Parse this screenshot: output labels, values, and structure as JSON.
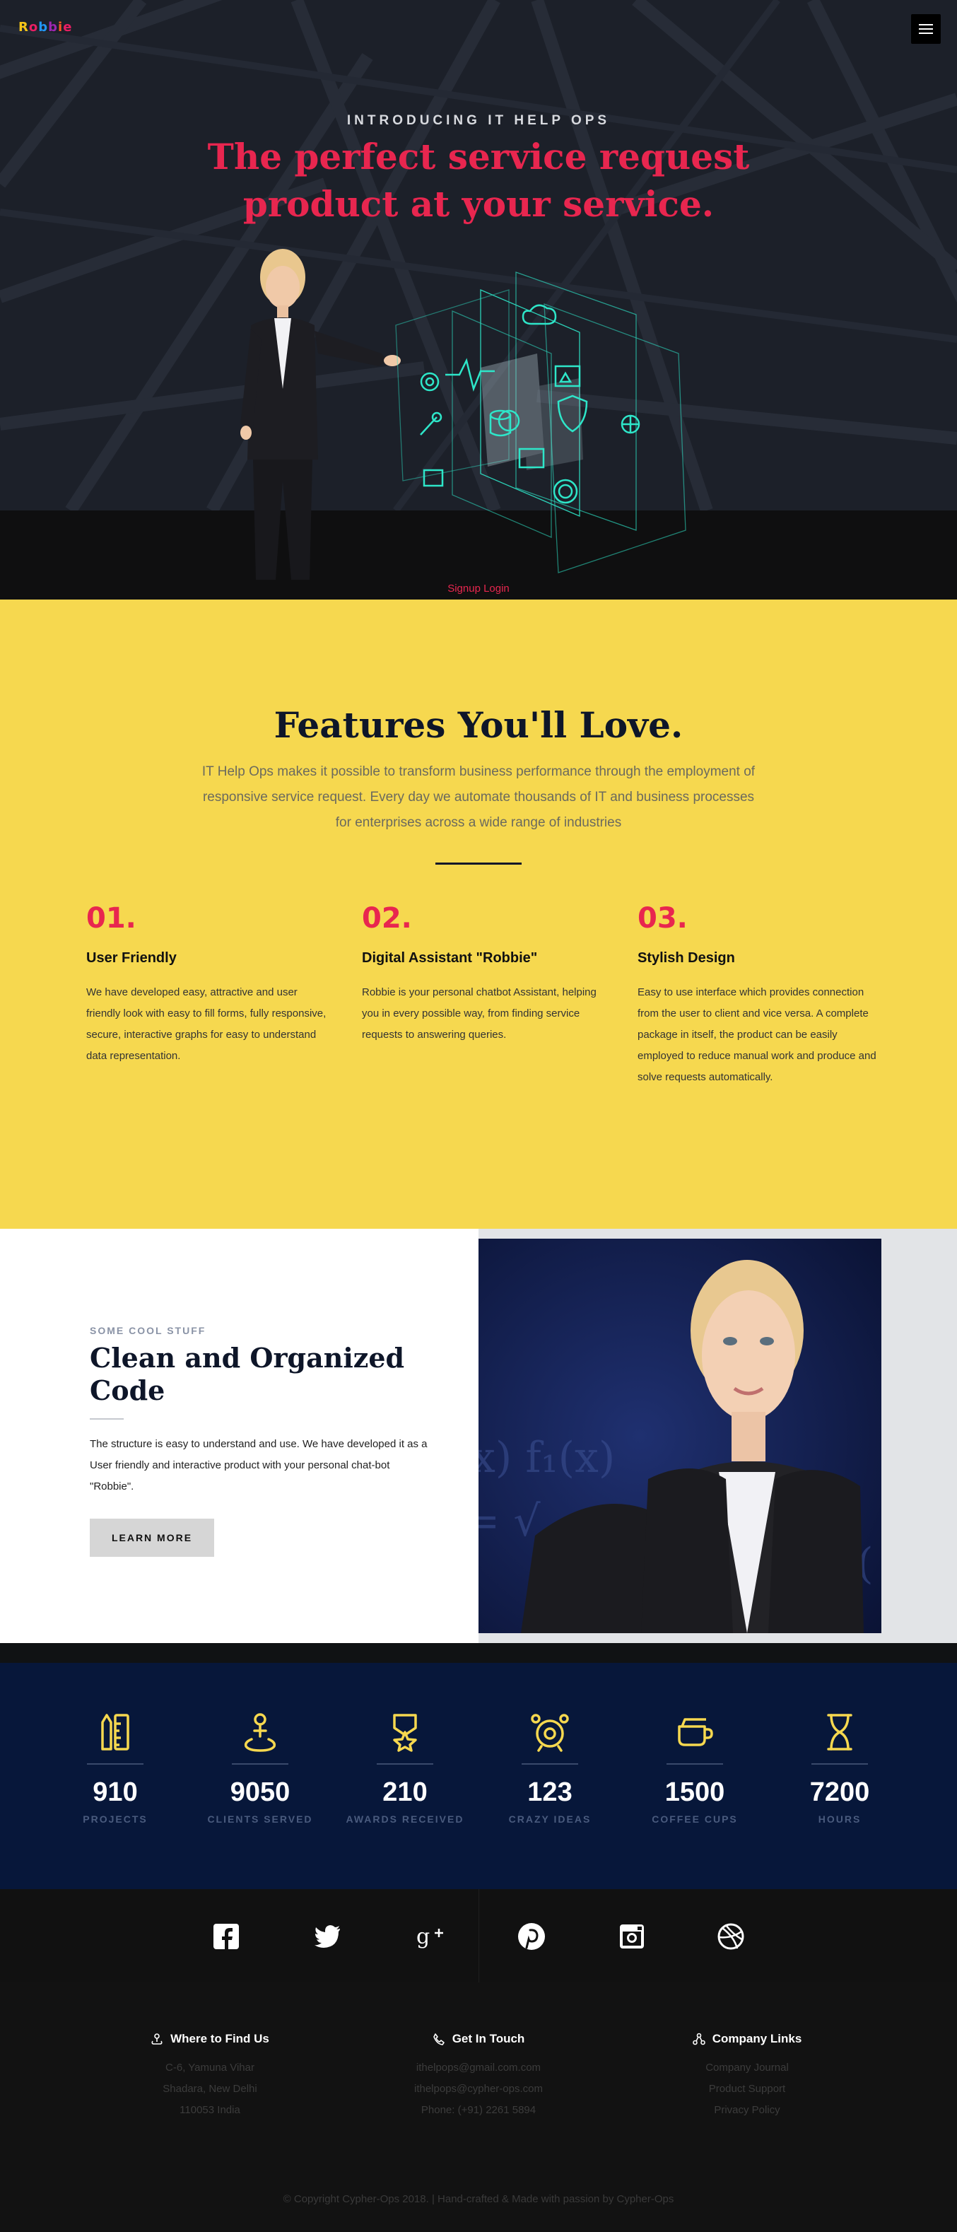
{
  "header": {
    "logo_text": "Robbie",
    "menu_icon": "hamburger-icon"
  },
  "hero": {
    "eyebrow": "INTRODUCING IT HELP OPS",
    "title": "The perfect service request product at your service.",
    "links": "Signup Login"
  },
  "features": {
    "title": "Features You'll Love.",
    "subtitle": "IT Help Ops makes it possible to transform business performance through the employment of responsive service request. Every day we automate thousands of IT and business processes for enterprises across a wide range of industries",
    "items": [
      {
        "num": "01.",
        "title": "User Friendly",
        "desc": "We have developed easy, attractive and user friendly look with easy to fill forms, fully responsive, secure, interactive graphs for easy to understand data representation."
      },
      {
        "num": "02.",
        "title": "Digital Assistant \"Robbie\"",
        "desc": "Robbie is your personal chatbot Assistant, helping you in every possible way, from finding service requests to answering queries."
      },
      {
        "num": "03.",
        "title": "Stylish Design",
        "desc": "Easy to use interface which provides connection from the user to client and vice versa. A complete package in itself, the product can be easily employed to reduce manual work and produce and solve requests automatically."
      }
    ]
  },
  "code_section": {
    "eyebrow": "SOME COOL STUFF",
    "title": "Clean and Organized Code",
    "desc": "The structure is easy to understand and use. We have developed it as a User friendly and interactive product with your personal chat-bot \"Robbie\".",
    "button": "LEARN MORE"
  },
  "stats": [
    {
      "icon": "ruler-pencil-icon",
      "value": "910",
      "label": "PROJECTS"
    },
    {
      "icon": "user-pin-icon",
      "value": "9050",
      "label": "CLIENTS SERVED"
    },
    {
      "icon": "award-medal-icon",
      "value": "210",
      "label": "AWARDS RECEIVED"
    },
    {
      "icon": "alarm-clock-icon",
      "value": "123",
      "label": "CRAZY IDEAS"
    },
    {
      "icon": "coffee-cup-icon",
      "value": "1500",
      "label": "COFFEE CUPS"
    },
    {
      "icon": "hourglass-icon",
      "value": "7200",
      "label": "HOURS"
    }
  ],
  "social": [
    {
      "icon": "facebook-icon"
    },
    {
      "icon": "twitter-icon"
    },
    {
      "icon": "google-plus-icon"
    },
    {
      "icon": "pinterest-icon"
    },
    {
      "icon": "instagram-icon"
    },
    {
      "icon": "dribbble-icon"
    }
  ],
  "footer": {
    "columns": [
      {
        "heading": "Where to Find Us",
        "icon": "map-pin-icon",
        "lines": [
          "C-6, Yamuna Vihar",
          "Shadara, New Delhi",
          "110053 India"
        ]
      },
      {
        "heading": "Get In Touch",
        "icon": "phone-icon",
        "lines": [
          "ithelpops@gmail.com.com",
          "ithelpops@cypher-ops.com",
          "Phone: (+91) 2261 5894"
        ]
      },
      {
        "heading": "Company Links",
        "icon": "network-icon",
        "lines": [
          "Company Journal",
          "Product Support",
          "Privacy Policy"
        ]
      }
    ],
    "copyright": "© Copyright Cypher-Ops 2018.  |   Hand-crafted & Made with passion by Cypher-Ops"
  },
  "colors": {
    "accent_red": "#e8264f",
    "features_yellow": "#f6d84f",
    "stats_navy": "#07173a",
    "stat_icon_yellow": "#f6d84f"
  }
}
